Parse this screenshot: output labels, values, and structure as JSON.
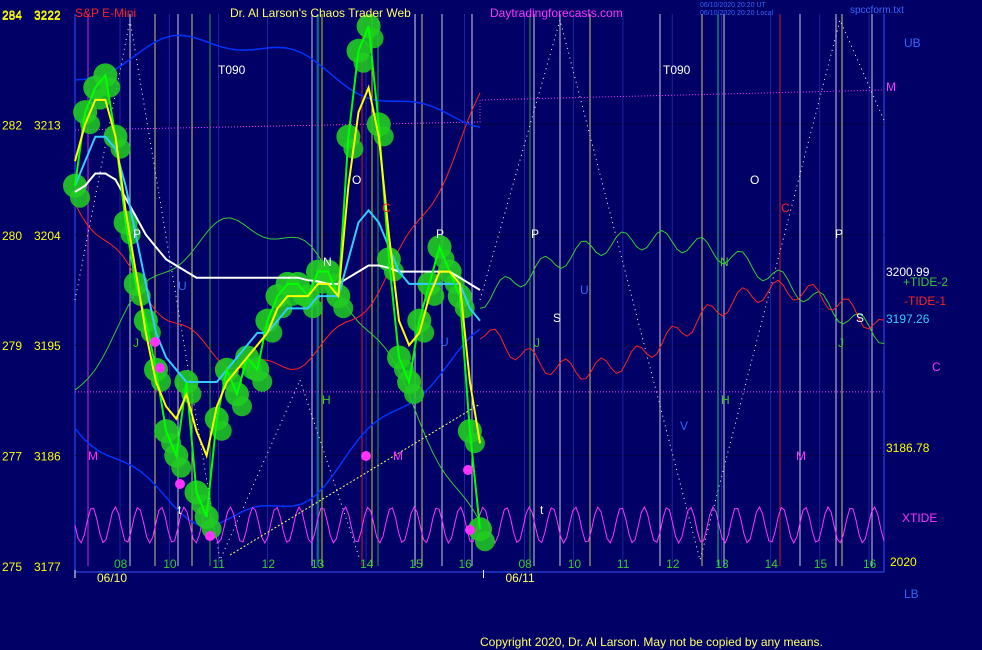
{
  "header": {
    "left_price_top": "284",
    "right_price_top": "3222",
    "instrument": "S&P E-Mini",
    "title": "Dr. Al Larson's Chaos Trader Web",
    "site": "Daytradingforecasts.com",
    "stamp_line1": "06/10/2020 20:20 UT",
    "stamp_line2": "06/10/2020 20:20 Local",
    "file": "spccform.txt"
  },
  "footer": {
    "copyright": "Copyright 2020, Dr. Al Larson. May not be copied by any means."
  },
  "colors": {
    "background": "#000066",
    "price_bar": "#00ff00",
    "bubble": "#22cc22",
    "ema_yellow": "#ffff00",
    "ema_cyan": "#33ccff",
    "ema_white": "#ffffff",
    "tide_plus": "#33cc33",
    "tide_minus": "#ff2222",
    "xtide": "#ff33ff",
    "bands": "#0033ff",
    "magenta_dot": "#ff33ff"
  },
  "chart_data": {
    "type": "line",
    "title": "S&P E-Mini",
    "x_axis": {
      "hour_ticks": [
        "08",
        "10",
        "11",
        "12",
        "13",
        "14",
        "15",
        "16",
        "08",
        "10",
        "11",
        "12",
        "13",
        "14",
        "15",
        "16"
      ],
      "dates": [
        "06/10",
        "06/11"
      ]
    },
    "y_axis_left": {
      "ticks": [
        284,
        282,
        280,
        279,
        277,
        275
      ]
    },
    "y_axis_right": {
      "ticks": [
        3222,
        3213,
        3204,
        3195,
        3186,
        3177
      ],
      "ylim": [
        3177,
        3222
      ]
    },
    "right_labels": {
      "ub": "UB",
      "m": "M",
      "v1": "3200.99",
      "tide2": "+TIDE-2",
      "tide1": "-TIDE-1",
      "v2": "3197.26",
      "c": "C",
      "v3": "3186.78",
      "xtide": "XTIDE",
      "year": "2020",
      "lb": "LB"
    },
    "levels": {
      "M_line": 3214.8,
      "C_line": 3191.2
    },
    "planet_markers_day1": [
      "T090",
      "P",
      "U",
      "J",
      "O",
      "C",
      "N",
      "H",
      "M",
      "t"
    ],
    "planet_markers_day2": [
      "T090",
      "P",
      "U",
      "S",
      "J",
      "N",
      "O",
      "C",
      "H",
      "M",
      "t",
      "P",
      "S",
      "J",
      "V"
    ],
    "series": [
      {
        "name": "price",
        "values": [
          3208,
          3214,
          3216,
          3217,
          3212,
          3205,
          3200,
          3197,
          3193,
          3188,
          3186,
          3192,
          3183,
          3181,
          3189,
          3193,
          3191,
          3194,
          3193,
          3197,
          3199,
          3200,
          3200,
          3199,
          3201,
          3201,
          3199,
          3212,
          3219,
          3221,
          3213,
          3202,
          3194,
          3192,
          3197,
          3200,
          3203,
          3201,
          3199,
          3188,
          3180
        ]
      },
      {
        "name": "ema-yellow",
        "values": [
          3210,
          3213,
          3215,
          3215,
          3212,
          3206,
          3201,
          3196,
          3192,
          3190,
          3189,
          3191,
          3188,
          3186,
          3190,
          3192,
          3193,
          3194,
          3195,
          3196,
          3198,
          3199,
          3199,
          3199,
          3200,
          3200,
          3199,
          3208,
          3214,
          3216,
          3212,
          3204,
          3197,
          3195,
          3196,
          3199,
          3201,
          3201,
          3200,
          3192,
          3187
        ]
      },
      {
        "name": "ema-cyan",
        "values": [
          3208,
          3210,
          3212,
          3212,
          3211,
          3208,
          3204,
          3200,
          3196,
          3194,
          3193,
          3192,
          3192,
          3192,
          3192,
          3193,
          3194,
          3195,
          3196,
          3196,
          3197,
          3198,
          3198,
          3198,
          3199,
          3199,
          3199,
          3202,
          3205,
          3206,
          3205,
          3203,
          3201,
          3200,
          3200,
          3200,
          3200,
          3200,
          3200,
          3198,
          3197
        ]
      },
      {
        "name": "ema-white",
        "values": [
          3207.5,
          3208,
          3209,
          3209,
          3208.5,
          3207,
          3205.5,
          3204,
          3203,
          3202,
          3201.5,
          3201,
          3200.5,
          3200.5,
          3200.5,
          3200.5,
          3200.5,
          3200.5,
          3200.5,
          3200.5,
          3200.5,
          3200.5,
          3200.5,
          3200.3,
          3200.2,
          3200,
          3200,
          3200.5,
          3201,
          3201.5,
          3201.5,
          3201.3,
          3201,
          3201,
          3201,
          3201,
          3201,
          3201,
          3200.5,
          3200,
          3199.5
        ]
      }
    ]
  }
}
